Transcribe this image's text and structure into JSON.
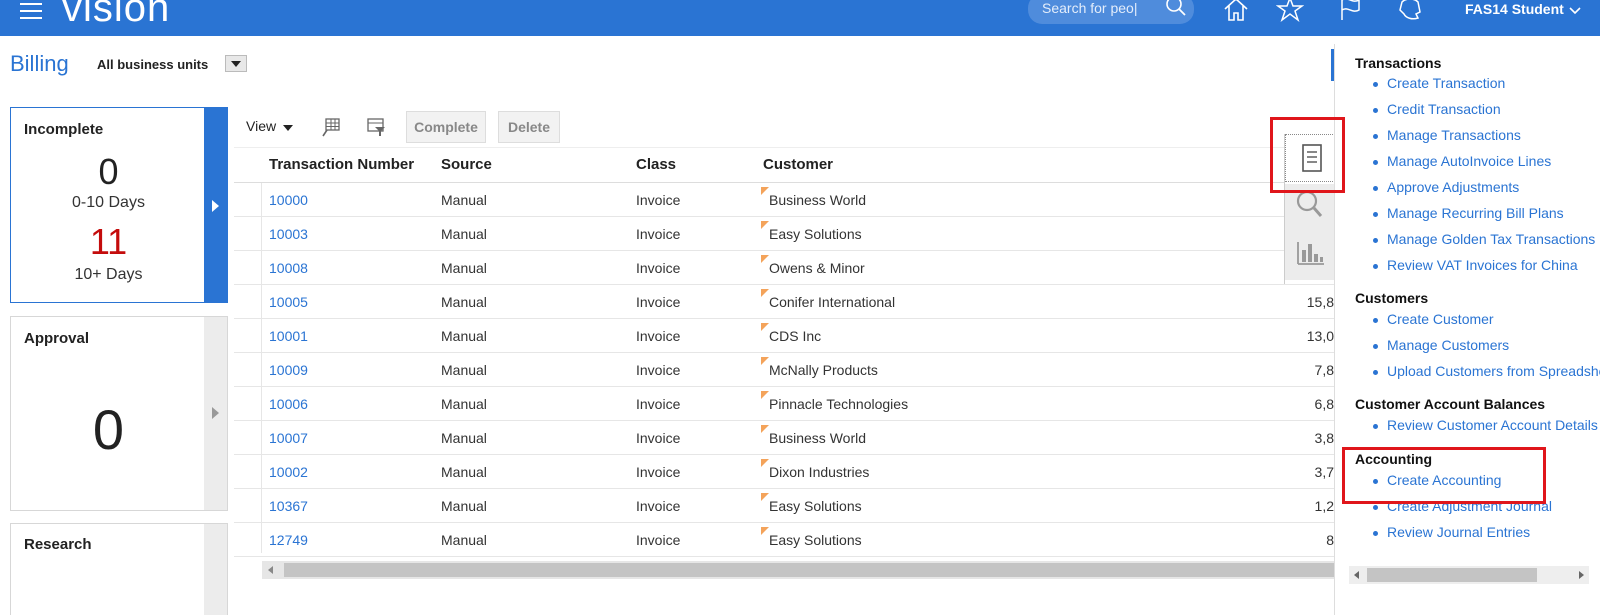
{
  "topbar": {
    "brand": "vision",
    "search_placeholder": "Search for peo|",
    "user_name": "FAS14 Student",
    "colors": {
      "bar": "#2a74d3"
    }
  },
  "page": {
    "title": "Billing",
    "business_unit": "All business units"
  },
  "tiles": {
    "incomplete": {
      "title": "Incomplete",
      "count_recent": "0",
      "recent_label": "0-10 Days",
      "count_old": "11",
      "old_label": "10+ Days"
    },
    "approval": {
      "title": "Approval",
      "count": "0"
    },
    "research": {
      "title": "Research"
    }
  },
  "toolbar": {
    "view_label": "View",
    "complete_label": "Complete",
    "delete_label": "Delete"
  },
  "table": {
    "headers": [
      "Transaction Number",
      "Source",
      "Class",
      "Customer"
    ],
    "rows": [
      {
        "number": "10000",
        "source": "Manual",
        "class": "Invoice",
        "customer": "Business World",
        "amount": ""
      },
      {
        "number": "10003",
        "source": "Manual",
        "class": "Invoice",
        "customer": "Easy Solutions",
        "amount": ""
      },
      {
        "number": "10008",
        "source": "Manual",
        "class": "Invoice",
        "customer": "Owens & Minor",
        "amount": ""
      },
      {
        "number": "10005",
        "source": "Manual",
        "class": "Invoice",
        "customer": "Conifer International",
        "amount": "15,8"
      },
      {
        "number": "10001",
        "source": "Manual",
        "class": "Invoice",
        "customer": "CDS Inc",
        "amount": "13,0"
      },
      {
        "number": "10009",
        "source": "Manual",
        "class": "Invoice",
        "customer": "McNally Products",
        "amount": "7,8"
      },
      {
        "number": "10006",
        "source": "Manual",
        "class": "Invoice",
        "customer": "Pinnacle Technologies",
        "amount": "6,8"
      },
      {
        "number": "10007",
        "source": "Manual",
        "class": "Invoice",
        "customer": "Business World",
        "amount": "3,8"
      },
      {
        "number": "10002",
        "source": "Manual",
        "class": "Invoice",
        "customer": "Dixon Industries",
        "amount": "3,7"
      },
      {
        "number": "10367",
        "source": "Manual",
        "class": "Invoice",
        "customer": "Easy Solutions",
        "amount": "1,2"
      },
      {
        "number": "12749",
        "source": "Manual",
        "class": "Invoice",
        "customer": "Easy Solutions",
        "amount": "8"
      }
    ]
  },
  "panel_tabs": [
    "tasks-icon",
    "search-icon",
    "chart-icon"
  ],
  "right_panel": {
    "sections": [
      {
        "title": "Transactions",
        "links": [
          "Create Transaction",
          "Credit Transaction",
          "Manage Transactions",
          "Manage AutoInvoice Lines",
          "Approve Adjustments",
          "Manage Recurring Bill Plans",
          "Manage Golden Tax Transactions",
          "Review VAT Invoices for China"
        ]
      },
      {
        "title": "Customers",
        "links": [
          "Create Customer",
          "Manage Customers",
          "Upload Customers from Spreadsheet"
        ]
      },
      {
        "title": "Customer Account Balances",
        "links": [
          "Review Customer Account Details"
        ]
      },
      {
        "title": "Accounting",
        "links": [
          "Create Accounting",
          "Create Adjustment Journal",
          "Review Journal Entries"
        ]
      }
    ]
  },
  "highlight_color": "#e0161b",
  "flag_color": "#f4a35a"
}
